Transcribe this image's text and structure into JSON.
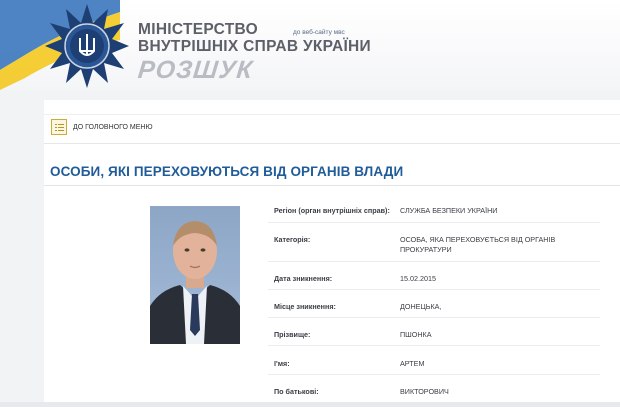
{
  "header": {
    "ministry_title": "МІНІСТЕРСТВО\nВНУТРІШНІХ СПРАВ УКРАЇНИ",
    "site_link": "до веб-сайту мвс",
    "search_word": "РОЗШУК"
  },
  "nav": {
    "menu_label": "ДО ГОЛОВНОГО МЕНЮ"
  },
  "page": {
    "title": "ОСОБИ, ЯКІ ПЕРЕХОВУЮТЬСЯ ВІД ОРГАНІВ ВЛАДИ"
  },
  "details": [
    {
      "label": "Регіон (орган внутрішніх справ):",
      "value": "СЛУЖБА БЕЗПЕКИ УКРАЇНИ"
    },
    {
      "label": "Категорія:",
      "value": "ОСОБА, ЯКА ПЕРЕХОВУЄТЬСЯ ВІД ОРГАНІВ ПРОКУРАТУРИ"
    },
    {
      "label": "Дата зникнення:",
      "value": "15.02.2015"
    },
    {
      "label": "Місце зникнення:",
      "value": "ДОНЕЦЬКА,"
    },
    {
      "label": "Прізвище:",
      "value": "ПШОНКА"
    },
    {
      "label": "І'мя:",
      "value": "АРТЕМ"
    },
    {
      "label": "По батькові:",
      "value": "ВИКТОРОВИЧ"
    }
  ],
  "colors": {
    "title_blue": "#1f5c99",
    "flag_blue": "#2f6fb8",
    "flag_yellow": "#f4c81f",
    "emblem_blue": "#1d3f73"
  }
}
